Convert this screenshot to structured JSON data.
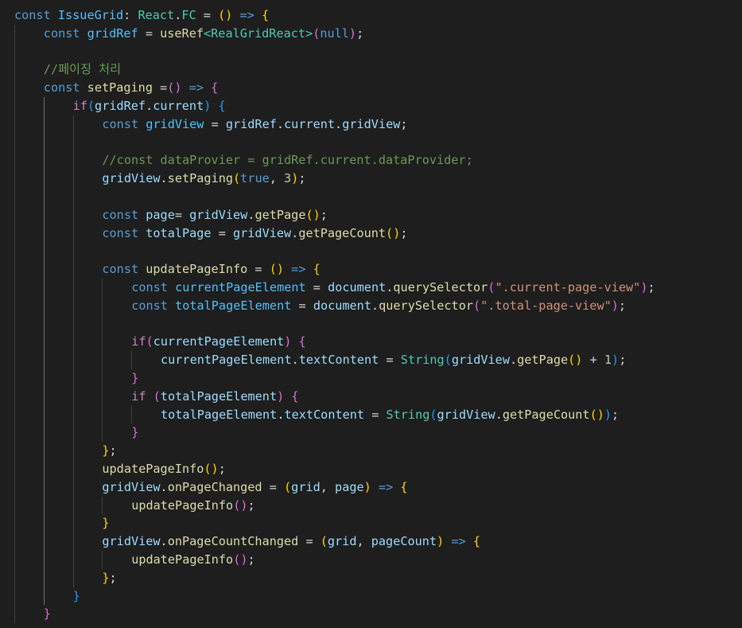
{
  "colors": {
    "background": "#1e1e1e",
    "keyword": "#569cd6",
    "control": "#c586c0",
    "variable": "#9cdcfe",
    "constant": "#4fc1ff",
    "function": "#dcdcaa",
    "type": "#4ec9b0",
    "string": "#ce9178",
    "number": "#b5cea8",
    "comment": "#6a9955",
    "plain": "#d4d4d4",
    "bracket1": "#ffd700",
    "bracket2": "#da70d6",
    "bracket3": "#179fff"
  },
  "code": {
    "lines": [
      {
        "indent": 0,
        "tokens": [
          [
            "const",
            "keyword"
          ],
          [
            " ",
            "plain"
          ],
          [
            "IssueGrid",
            "constant"
          ],
          [
            ": ",
            "plain"
          ],
          [
            "React",
            "type"
          ],
          [
            ".",
            "plain"
          ],
          [
            "FC",
            "type"
          ],
          [
            " = ",
            "plain"
          ],
          [
            "()",
            "bracket1"
          ],
          [
            " ",
            "plain"
          ],
          [
            "=>",
            "keyword"
          ],
          [
            " ",
            "plain"
          ],
          [
            "{",
            "bracket1"
          ]
        ]
      },
      {
        "indent": 1,
        "tokens": [
          [
            "const",
            "keyword"
          ],
          [
            " ",
            "plain"
          ],
          [
            "gridRef",
            "constant"
          ],
          [
            " = ",
            "plain"
          ],
          [
            "useRef",
            "function"
          ],
          [
            "<",
            "type"
          ],
          [
            "RealGridReact",
            "type"
          ],
          [
            ">",
            "type"
          ],
          [
            "(",
            "bracket2"
          ],
          [
            "null",
            "keyword"
          ],
          [
            ")",
            "bracket2"
          ],
          [
            ";",
            "plain"
          ]
        ]
      },
      {
        "indent": 1,
        "tokens": []
      },
      {
        "indent": 1,
        "tokens": [
          [
            "//페이징 처리",
            "comment"
          ]
        ]
      },
      {
        "indent": 1,
        "tokens": [
          [
            "const",
            "keyword"
          ],
          [
            " ",
            "plain"
          ],
          [
            "setPaging",
            "function"
          ],
          [
            " =",
            "plain"
          ],
          [
            "()",
            "bracket2"
          ],
          [
            " ",
            "plain"
          ],
          [
            "=>",
            "keyword"
          ],
          [
            " ",
            "plain"
          ],
          [
            "{",
            "bracket2"
          ]
        ]
      },
      {
        "indent": 2,
        "tokens": [
          [
            "if",
            "control"
          ],
          [
            "(",
            "bracket3"
          ],
          [
            "gridRef",
            "variable"
          ],
          [
            ".",
            "plain"
          ],
          [
            "current",
            "variable"
          ],
          [
            ")",
            "bracket3"
          ],
          [
            " ",
            "plain"
          ],
          [
            "{",
            "bracket3"
          ]
        ]
      },
      {
        "indent": 3,
        "tokens": [
          [
            "const",
            "keyword"
          ],
          [
            " ",
            "plain"
          ],
          [
            "gridView",
            "constant"
          ],
          [
            " = ",
            "plain"
          ],
          [
            "gridRef",
            "variable"
          ],
          [
            ".",
            "plain"
          ],
          [
            "current",
            "variable"
          ],
          [
            ".",
            "plain"
          ],
          [
            "gridView",
            "variable"
          ],
          [
            ";",
            "plain"
          ]
        ]
      },
      {
        "indent": 3,
        "tokens": []
      },
      {
        "indent": 3,
        "tokens": [
          [
            "//const dataProvier = gridRef.current.dataProvider;",
            "comment"
          ]
        ]
      },
      {
        "indent": 3,
        "tokens": [
          [
            "gridView",
            "variable"
          ],
          [
            ".",
            "plain"
          ],
          [
            "setPaging",
            "function"
          ],
          [
            "(",
            "bracket1"
          ],
          [
            "true",
            "keyword"
          ],
          [
            ", ",
            "plain"
          ],
          [
            "3",
            "number"
          ],
          [
            ")",
            "bracket1"
          ],
          [
            ";",
            "plain"
          ]
        ]
      },
      {
        "indent": 3,
        "tokens": []
      },
      {
        "indent": 3,
        "tokens": [
          [
            "const",
            "keyword"
          ],
          [
            " ",
            "plain"
          ],
          [
            "page",
            "variable"
          ],
          [
            "= ",
            "plain"
          ],
          [
            "gridView",
            "variable"
          ],
          [
            ".",
            "plain"
          ],
          [
            "getPage",
            "function"
          ],
          [
            "()",
            "bracket1"
          ],
          [
            ";",
            "plain"
          ]
        ]
      },
      {
        "indent": 3,
        "tokens": [
          [
            "const",
            "keyword"
          ],
          [
            " ",
            "plain"
          ],
          [
            "totalPage",
            "variable"
          ],
          [
            " = ",
            "plain"
          ],
          [
            "gridView",
            "variable"
          ],
          [
            ".",
            "plain"
          ],
          [
            "getPageCount",
            "function"
          ],
          [
            "()",
            "bracket1"
          ],
          [
            ";",
            "plain"
          ]
        ]
      },
      {
        "indent": 3,
        "tokens": []
      },
      {
        "indent": 3,
        "tokens": [
          [
            "const",
            "keyword"
          ],
          [
            " ",
            "plain"
          ],
          [
            "updatePageInfo",
            "function"
          ],
          [
            " = ",
            "plain"
          ],
          [
            "()",
            "bracket1"
          ],
          [
            " ",
            "plain"
          ],
          [
            "=>",
            "keyword"
          ],
          [
            " ",
            "plain"
          ],
          [
            "{",
            "bracket1"
          ]
        ]
      },
      {
        "indent": 4,
        "tokens": [
          [
            "const",
            "keyword"
          ],
          [
            " ",
            "plain"
          ],
          [
            "currentPageElement",
            "constant"
          ],
          [
            " = ",
            "plain"
          ],
          [
            "document",
            "variable"
          ],
          [
            ".",
            "plain"
          ],
          [
            "querySelector",
            "function"
          ],
          [
            "(",
            "bracket2"
          ],
          [
            "\".current-page-view\"",
            "string"
          ],
          [
            ")",
            "bracket2"
          ],
          [
            ";",
            "plain"
          ]
        ]
      },
      {
        "indent": 4,
        "tokens": [
          [
            "const",
            "keyword"
          ],
          [
            " ",
            "plain"
          ],
          [
            "totalPageElement",
            "constant"
          ],
          [
            " = ",
            "plain"
          ],
          [
            "document",
            "variable"
          ],
          [
            ".",
            "plain"
          ],
          [
            "querySelector",
            "function"
          ],
          [
            "(",
            "bracket2"
          ],
          [
            "\".total-page-view\"",
            "string"
          ],
          [
            ")",
            "bracket2"
          ],
          [
            ";",
            "plain"
          ]
        ]
      },
      {
        "indent": 4,
        "tokens": []
      },
      {
        "indent": 4,
        "tokens": [
          [
            "if",
            "control"
          ],
          [
            "(",
            "bracket2"
          ],
          [
            "currentPageElement",
            "variable"
          ],
          [
            ")",
            "bracket2"
          ],
          [
            " ",
            "plain"
          ],
          [
            "{",
            "bracket2"
          ]
        ]
      },
      {
        "indent": 5,
        "tokens": [
          [
            "currentPageElement",
            "variable"
          ],
          [
            ".",
            "plain"
          ],
          [
            "textContent",
            "variable"
          ],
          [
            " = ",
            "plain"
          ],
          [
            "String",
            "type"
          ],
          [
            "(",
            "bracket3"
          ],
          [
            "gridView",
            "variable"
          ],
          [
            ".",
            "plain"
          ],
          [
            "getPage",
            "function"
          ],
          [
            "()",
            "bracket1"
          ],
          [
            " + ",
            "plain"
          ],
          [
            "1",
            "number"
          ],
          [
            ")",
            "bracket3"
          ],
          [
            ";",
            "plain"
          ]
        ]
      },
      {
        "indent": 4,
        "tokens": [
          [
            "}",
            "bracket2"
          ]
        ]
      },
      {
        "indent": 4,
        "tokens": [
          [
            "if",
            "control"
          ],
          [
            " ",
            "plain"
          ],
          [
            "(",
            "bracket2"
          ],
          [
            "totalPageElement",
            "variable"
          ],
          [
            ")",
            "bracket2"
          ],
          [
            " ",
            "plain"
          ],
          [
            "{",
            "bracket2"
          ]
        ]
      },
      {
        "indent": 5,
        "tokens": [
          [
            "totalPageElement",
            "variable"
          ],
          [
            ".",
            "plain"
          ],
          [
            "textContent",
            "variable"
          ],
          [
            " = ",
            "plain"
          ],
          [
            "String",
            "type"
          ],
          [
            "(",
            "bracket3"
          ],
          [
            "gridView",
            "variable"
          ],
          [
            ".",
            "plain"
          ],
          [
            "getPageCount",
            "function"
          ],
          [
            "()",
            "bracket1"
          ],
          [
            ")",
            "bracket3"
          ],
          [
            ";",
            "plain"
          ]
        ]
      },
      {
        "indent": 4,
        "tokens": [
          [
            "}",
            "bracket2"
          ]
        ]
      },
      {
        "indent": 3,
        "tokens": [
          [
            "}",
            "bracket1"
          ],
          [
            ";",
            "plain"
          ]
        ]
      },
      {
        "indent": 3,
        "tokens": [
          [
            "updatePageInfo",
            "function"
          ],
          [
            "()",
            "bracket1"
          ],
          [
            ";",
            "plain"
          ]
        ]
      },
      {
        "indent": 3,
        "tokens": [
          [
            "gridView",
            "variable"
          ],
          [
            ".",
            "plain"
          ],
          [
            "onPageChanged",
            "function"
          ],
          [
            " = ",
            "plain"
          ],
          [
            "(",
            "bracket1"
          ],
          [
            "grid",
            "variable"
          ],
          [
            ", ",
            "plain"
          ],
          [
            "page",
            "variable"
          ],
          [
            ")",
            "bracket1"
          ],
          [
            " ",
            "plain"
          ],
          [
            "=>",
            "keyword"
          ],
          [
            " ",
            "plain"
          ],
          [
            "{",
            "bracket1"
          ]
        ]
      },
      {
        "indent": 4,
        "tokens": [
          [
            "updatePageInfo",
            "function"
          ],
          [
            "()",
            "bracket2"
          ],
          [
            ";",
            "plain"
          ]
        ]
      },
      {
        "indent": 3,
        "tokens": [
          [
            "}",
            "bracket1"
          ]
        ]
      },
      {
        "indent": 3,
        "tokens": [
          [
            "gridView",
            "variable"
          ],
          [
            ".",
            "plain"
          ],
          [
            "onPageCountChanged",
            "function"
          ],
          [
            " = ",
            "plain"
          ],
          [
            "(",
            "bracket1"
          ],
          [
            "grid",
            "variable"
          ],
          [
            ", ",
            "plain"
          ],
          [
            "pageCount",
            "variable"
          ],
          [
            ")",
            "bracket1"
          ],
          [
            " ",
            "plain"
          ],
          [
            "=>",
            "keyword"
          ],
          [
            " ",
            "plain"
          ],
          [
            "{",
            "bracket1"
          ]
        ]
      },
      {
        "indent": 4,
        "tokens": [
          [
            "updatePageInfo",
            "function"
          ],
          [
            "()",
            "bracket2"
          ],
          [
            ";",
            "plain"
          ]
        ]
      },
      {
        "indent": 3,
        "tokens": [
          [
            "}",
            "bracket1"
          ],
          [
            ";",
            "plain"
          ]
        ]
      },
      {
        "indent": 2,
        "tokens": [
          [
            "}",
            "bracket3"
          ]
        ]
      },
      {
        "indent": 1,
        "tokens": [
          [
            "}",
            "bracket2"
          ]
        ]
      }
    ]
  }
}
